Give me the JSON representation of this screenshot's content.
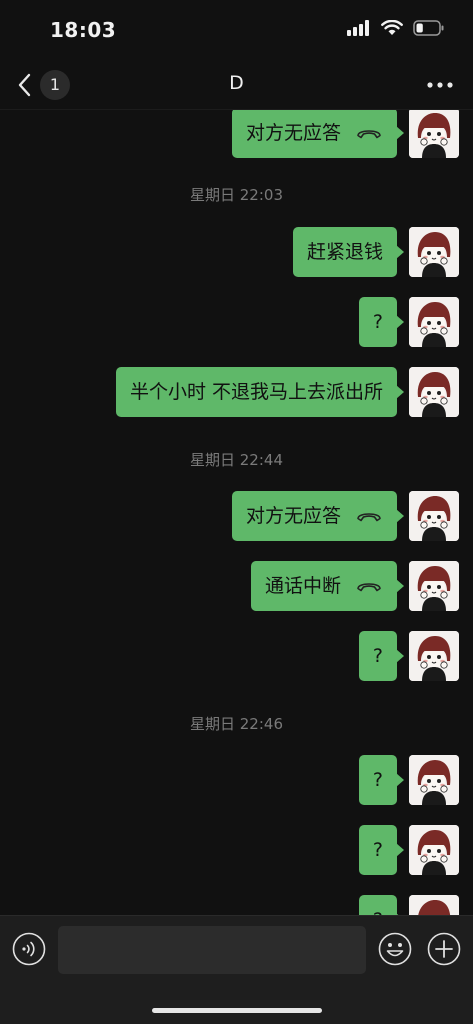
{
  "status_bar": {
    "time": "18:03",
    "battery_level": 0.3
  },
  "nav": {
    "back_count": "1",
    "title": "D"
  },
  "messages": [
    {
      "text": "对方无应答",
      "kind": "call"
    },
    {
      "text": "赶紧退钱",
      "kind": "text"
    },
    {
      "text": "?",
      "kind": "text"
    },
    {
      "text": "半个小时 不退我马上去派出所",
      "kind": "text"
    },
    {
      "text": "对方无应答",
      "kind": "call"
    },
    {
      "text": "通话中断",
      "kind": "call"
    },
    {
      "text": "?",
      "kind": "text"
    },
    {
      "text": "?",
      "kind": "text"
    },
    {
      "text": "?",
      "kind": "text"
    },
    {
      "text": "?",
      "kind": "text"
    }
  ],
  "timestamps": [
    "星期日 22:03",
    "星期日 22:44",
    "星期日 22:46"
  ],
  "input": {
    "value": "",
    "placeholder": ""
  },
  "icons": {
    "back": "chevron-left-icon",
    "more": "more-icon",
    "call": "hang-up-phone-icon",
    "voice": "voice-icon",
    "emoji": "emoji-icon",
    "plus": "plus-icon"
  },
  "colors": {
    "bubble": "#5fb869",
    "background": "#111111",
    "timestamp": "#7a7a7a"
  }
}
